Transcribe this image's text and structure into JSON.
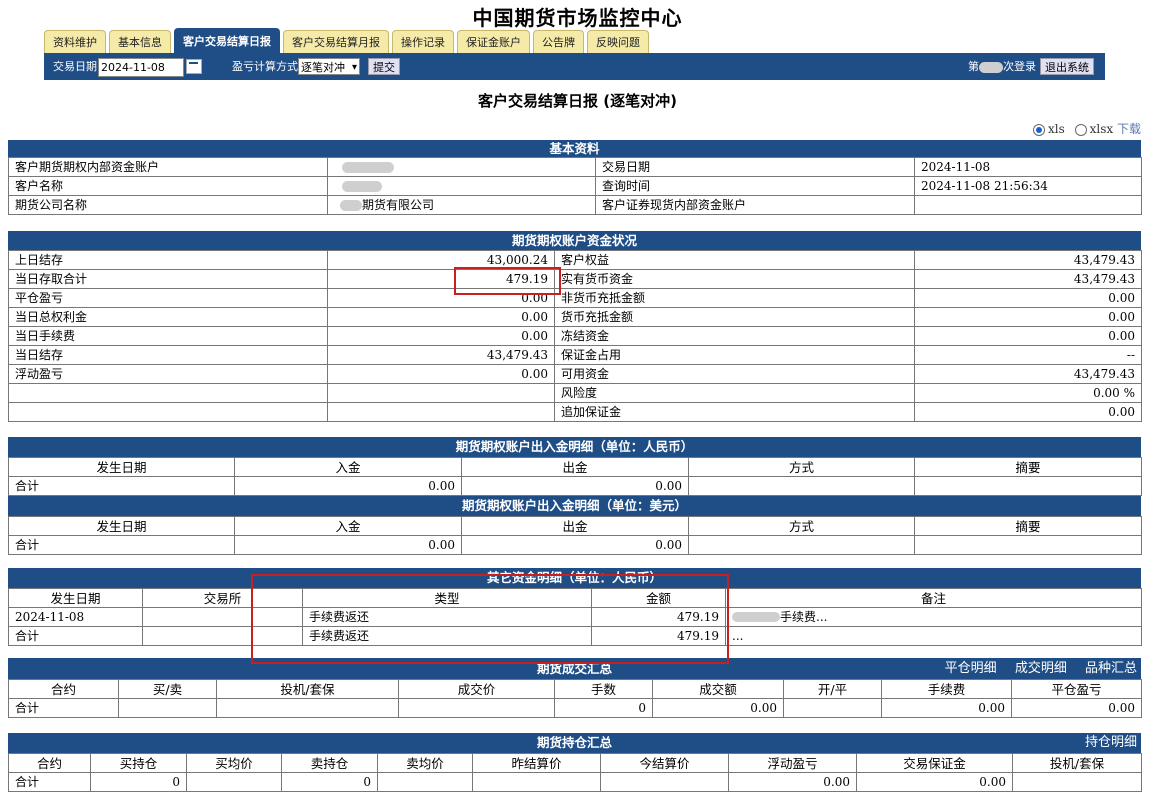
{
  "site_title": "中国期货市场监控中心",
  "tabs": [
    "资料维护",
    "基本信息",
    "客户交易结算日报",
    "客户交易结算月报",
    "操作记录",
    "保证金账户",
    "公告牌",
    "反映问题"
  ],
  "toolbar": {
    "date_label": "交易日期",
    "date_value": "2024-11-08",
    "method_label": "盈亏计算方式",
    "method_value": "逐笔对冲",
    "submit": "提交",
    "login_prefix": "第",
    "login_suffix": "次登录",
    "logout": "退出系统"
  },
  "page_title": "客户交易结算日报 (逐笔对冲)",
  "export": {
    "opt1": "xls",
    "opt2": "xlsx",
    "download": "下载"
  },
  "basic": {
    "title": "基本资料",
    "rows": [
      {
        "l1": "客户期货期权内部资金账户",
        "v1": "",
        "l2": "交易日期",
        "v2": "2024-11-08"
      },
      {
        "l1": "客户名称",
        "v1": "",
        "l2": "查询时间",
        "v2": "2024-11-08 21:56:34"
      },
      {
        "l1": "期货公司名称",
        "v1": "期货有限公司",
        "l2": "客户证券现货内部资金账户",
        "v2": ""
      }
    ]
  },
  "funds": {
    "title": "期货期权账户资金状况",
    "rows": [
      {
        "l1": "上日结存",
        "v1": "43,000.24",
        "l2": "客户权益",
        "v2": "43,479.43"
      },
      {
        "l1": "当日存取合计",
        "v1": "479.19",
        "l2": "实有货币资金",
        "v2": "43,479.43"
      },
      {
        "l1": "平仓盈亏",
        "v1": "0.00",
        "l2": "非货币充抵金额",
        "v2": "0.00"
      },
      {
        "l1": "当日总权利金",
        "v1": "0.00",
        "l2": "货币充抵金额",
        "v2": "0.00"
      },
      {
        "l1": "当日手续费",
        "v1": "0.00",
        "l2": "冻结资金",
        "v2": "0.00"
      },
      {
        "l1": "当日结存",
        "v1": "43,479.43",
        "l2": "保证金占用",
        "v2": "--"
      },
      {
        "l1": "浮动盈亏",
        "v1": "0.00",
        "l2": "可用资金",
        "v2": "43,479.43"
      },
      {
        "l1": "",
        "v1": "",
        "l2": "风险度",
        "v2": "0.00 %"
      },
      {
        "l1": "",
        "v1": "",
        "l2": "追加保证金",
        "v2": "0.00"
      }
    ]
  },
  "inout_rmb": {
    "title": "期货期权账户出入金明细（单位：人民币）",
    "headers": [
      "发生日期",
      "入金",
      "出金",
      "方式",
      "摘要"
    ],
    "total": {
      "label": "合计",
      "in": "0.00",
      "out": "0.00"
    }
  },
  "inout_usd": {
    "title": "期货期权账户出入金明细（单位：美元）",
    "headers": [
      "发生日期",
      "入金",
      "出金",
      "方式",
      "摘要"
    ],
    "total": {
      "label": "合计",
      "in": "0.00",
      "out": "0.00"
    }
  },
  "other": {
    "title": "其它资金明细（单位：人民币）",
    "headers": [
      "发生日期",
      "交易所",
      "类型",
      "金额",
      "备注"
    ],
    "row": {
      "date": "2024-11-08",
      "exchange": "",
      "type": "手续费返还",
      "amount": "479.19",
      "note": "手续费..."
    },
    "total": {
      "label": "合计",
      "type": "手续费返还",
      "amount": "479.19",
      "note": "..."
    }
  },
  "trade": {
    "title": "期货成交汇总",
    "links": [
      "平仓明细",
      "成交明细",
      "品种汇总"
    ],
    "headers": [
      "合约",
      "买/卖",
      "投机/套保",
      "成交价",
      "手数",
      "成交额",
      "开/平",
      "手续费",
      "平仓盈亏"
    ],
    "total": {
      "label": "合计",
      "lots": "0",
      "amount": "0.00",
      "fee": "0.00",
      "pnl": "0.00"
    }
  },
  "position": {
    "title": "期货持仓汇总",
    "links": [
      "持仓明细"
    ],
    "headers": [
      "合约",
      "买持仓",
      "买均价",
      "卖持仓",
      "卖均价",
      "昨结算价",
      "今结算价",
      "浮动盈亏",
      "交易保证金",
      "投机/套保"
    ],
    "total": {
      "label": "合计",
      "buy": "0",
      "sell": "0",
      "float": "0.00",
      "margin": "0.00"
    }
  }
}
